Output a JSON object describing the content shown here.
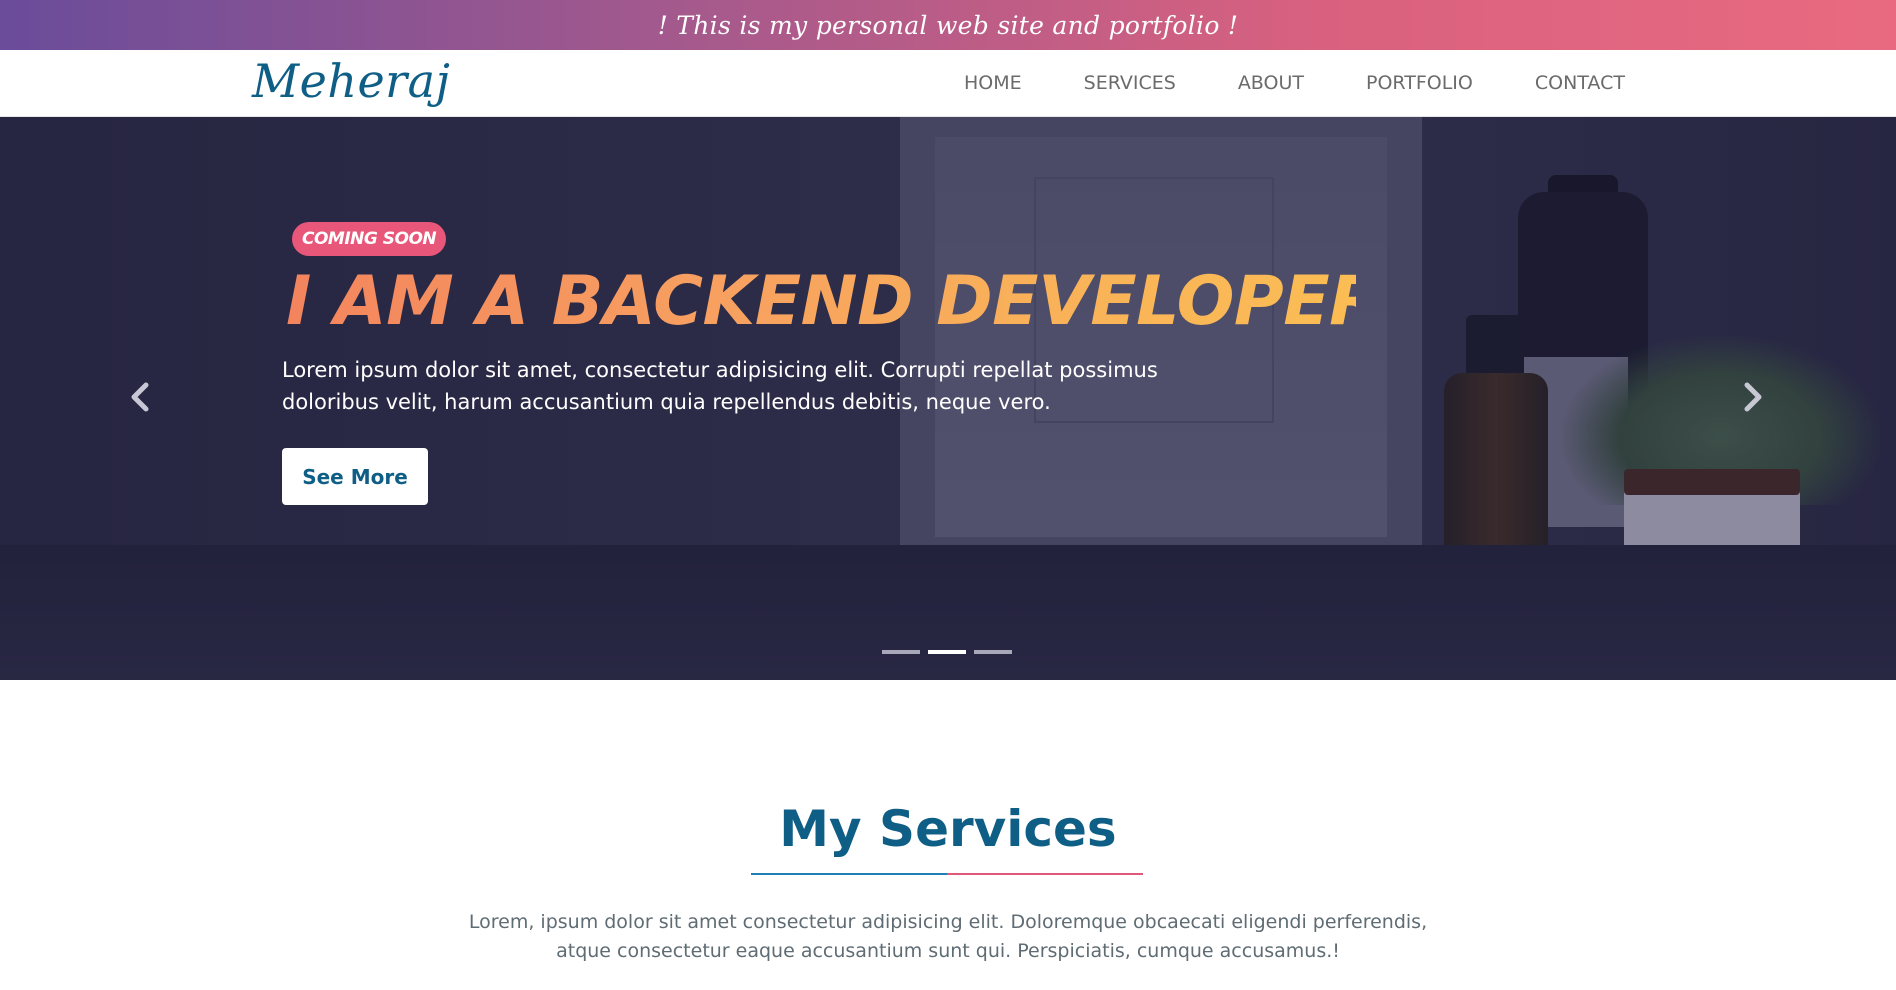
{
  "topbar": {
    "text": "! This is my personal web site and portfolio !"
  },
  "header": {
    "logo": "Meheraj",
    "nav": [
      "HOME",
      "SERVICES",
      "ABOUT",
      "PORTFOLIO",
      "CONTACT"
    ]
  },
  "hero": {
    "badge": "COMING SOON",
    "title": "I AM A BACKEND DEVELOPER",
    "description": "Lorem ipsum dolor sit amet, consectetur adipisicing elit. Corrupti repellat possimus doloribus velit, harum accusantium quia repellendus debitis, neque vero.",
    "button": "See More",
    "prev_icon": "chevron-left-icon",
    "next_icon": "chevron-right-icon",
    "slides": 3,
    "active_slide": 2
  },
  "services": {
    "title": "My Services",
    "desc_line1": "Lorem, ipsum dolor sit amet consectetur adipisicing elit. Doloremque obcaecati eligendi perferendis,",
    "desc_line2": "atque consectetur eaque accusantium sunt qui. Perspiciatis, cumque accusamus.!"
  },
  "colors": {
    "brand": "#0f5e86",
    "accent_pink": "#e8577a",
    "title_gradient_start": "#f3845e",
    "title_gradient_end": "#fbbd54"
  }
}
